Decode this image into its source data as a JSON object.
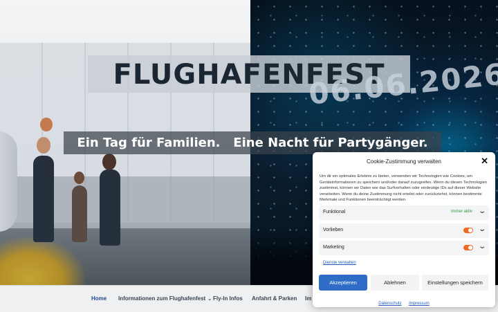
{
  "hero": {
    "title": "FLUGHAFENFEST",
    "date": "06.06.2026",
    "tagline": "Ein Tag für Familien.   Eine Nacht für Partygänger."
  },
  "nav": {
    "items": [
      {
        "label": "Home",
        "active": true
      },
      {
        "label": "Informationen zum Flughafenfest",
        "has_submenu": true
      },
      {
        "label": "Fly-In Infos"
      },
      {
        "label": "Anfahrt & Parken"
      },
      {
        "label": "Im"
      }
    ]
  },
  "cookie": {
    "title": "Cookie-Zustimmung verwalten",
    "text": "Um dir ein optimales Erlebnis zu bieten, verwenden wir Technologien wie Cookies, um Geräteinformationen zu speichern und/oder darauf zuzugreifen. Wenn du diesen Technologien zustimmst, können wir Daten wie das Surfverhalten oder eindeutige IDs auf dieser Website verarbeiten. Wenn du deine Zustimmung nicht erteilst oder zurückziehst, können bestimmte Merkmale und Funktionen beeinträchtigt werden.",
    "categories": [
      {
        "label": "Funktional",
        "status": "Immer aktiv"
      },
      {
        "label": "Vorlieben",
        "enabled": false
      },
      {
        "label": "Marketing",
        "enabled": false
      }
    ],
    "services_link": "Dienste verwalten",
    "accept": "Akzeptieren",
    "deny": "Ablehnen",
    "settings": "Einstellungen speichern",
    "privacy_link": "Datenschutz",
    "imprint_link": "Impressum",
    "colors": {
      "accent": "#2e6cc8",
      "toggle": "#f26a21",
      "active": "#2d9b3b"
    }
  }
}
